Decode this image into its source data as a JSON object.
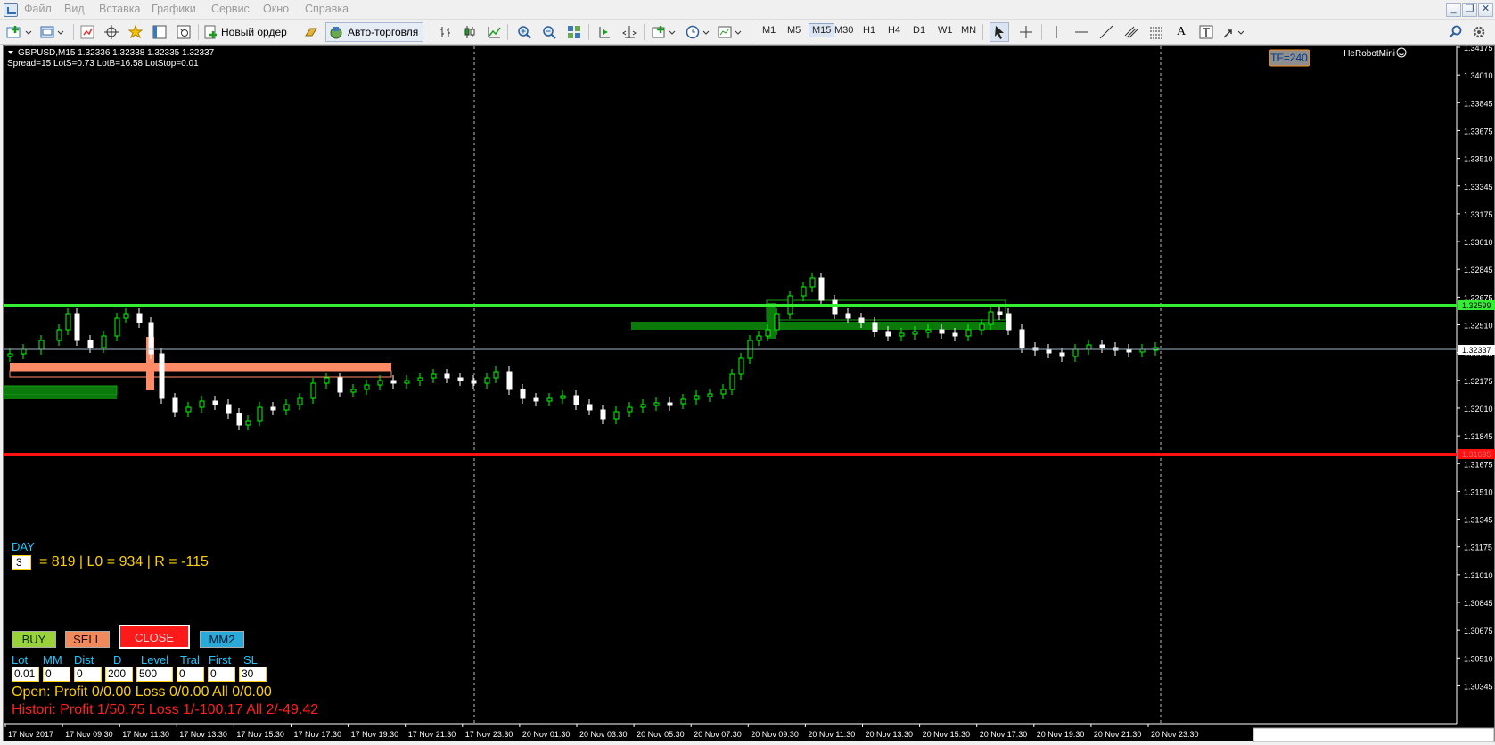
{
  "menu": {
    "items": [
      "Файл",
      "Вид",
      "Вставка",
      "Графики",
      "Сервис",
      "Окно",
      "Справка"
    ]
  },
  "window_controls": [
    "minimize",
    "restore",
    "close"
  ],
  "toolbar": {
    "new_order_label": "Новый ордер",
    "autotrade_label": "Авто-торговля",
    "timeframes": [
      "M1",
      "M5",
      "M15",
      "M30",
      "H1",
      "H4",
      "D1",
      "W1",
      "MN"
    ],
    "active_timeframe": "M15",
    "text_tool_label": "A"
  },
  "chart": {
    "header": "GBPUSD,M15  1.32336 1.32338 1.32335 1.32337",
    "info_line": "Spread=15  LotS=0.73  LotB=16.58  LotStop=0.01",
    "tf_badge": "TF=240",
    "expert_label": "HeRobotMini",
    "price_labels": [
      "1.34175",
      "1.34010",
      "1.33845",
      "1.33675",
      "1.33510",
      "1.33345",
      "1.33175",
      "1.33010",
      "1.32845",
      "1.32675",
      "1.32510",
      "1.32345",
      "1.32175",
      "1.32010",
      "1.31845",
      "1.31675",
      "1.31510",
      "1.31345",
      "1.31175",
      "1.31010",
      "1.30845",
      "1.30675",
      "1.30510",
      "1.30345"
    ],
    "current_price": "1.32337",
    "resistance_price": "1.32599",
    "support_price": "1.31695",
    "time_labels": [
      "17 Nov 2017",
      "17 Nov 09:30",
      "17 Nov 11:30",
      "17 Nov 13:30",
      "17 Nov 15:30",
      "17 Nov 17:30",
      "17 Nov 19:30",
      "17 Nov 21:30",
      "17 Nov 23:30",
      "20 Nov 01:30",
      "20 Nov 03:30",
      "20 Nov 05:30",
      "20 Nov 07:30",
      "20 Nov 09:30",
      "20 Nov 11:30",
      "20 Nov 13:30",
      "20 Nov 15:30",
      "20 Nov 17:30",
      "20 Nov 19:30",
      "20 Nov 21:30",
      "20 Nov 23:30"
    ],
    "colors": {
      "background": "#000000",
      "bull": "#00ff00",
      "bear": "#ffffff",
      "resistance": "#33ee33",
      "support": "#ff1111",
      "sell_zone": "#ff8a66",
      "buy_zone": "#0b7a0b",
      "axis_text": "#ffffff"
    }
  },
  "panel": {
    "day_label": "DAY",
    "day_value": "3",
    "stats_text": "= 819 | L0 = 934 | R = -115",
    "buy_label": "BUY",
    "sell_label": "SELL",
    "close_label": "CLOSE",
    "mm2_label": "MM2",
    "fields": [
      {
        "label": "Lot",
        "value": "0.01"
      },
      {
        "label": "MM",
        "value": "0"
      },
      {
        "label": "Dist",
        "value": "0"
      },
      {
        "label": "D",
        "value": "200"
      },
      {
        "label": "Level",
        "value": "500"
      },
      {
        "label": "Tral",
        "value": "0"
      },
      {
        "label": "First",
        "value": "0"
      },
      {
        "label": "SL",
        "value": "30"
      }
    ],
    "open_text": "Open:  Profit 0/0.00  Loss 0/0.00  All 0/0.00",
    "history_text": "Histori: Profit 1/50.75  Loss 1/-100.17  All 2/-49.42",
    "colors": {
      "buy_bg": "#9bd23c",
      "sell_bg": "#f08a5d",
      "close_bg": "#ff1a1a",
      "mm2_bg": "#2aa9d9",
      "yellow_text": "#ffd000",
      "red_text": "#ff2020",
      "cyan_text": "#1ec8ff"
    }
  }
}
